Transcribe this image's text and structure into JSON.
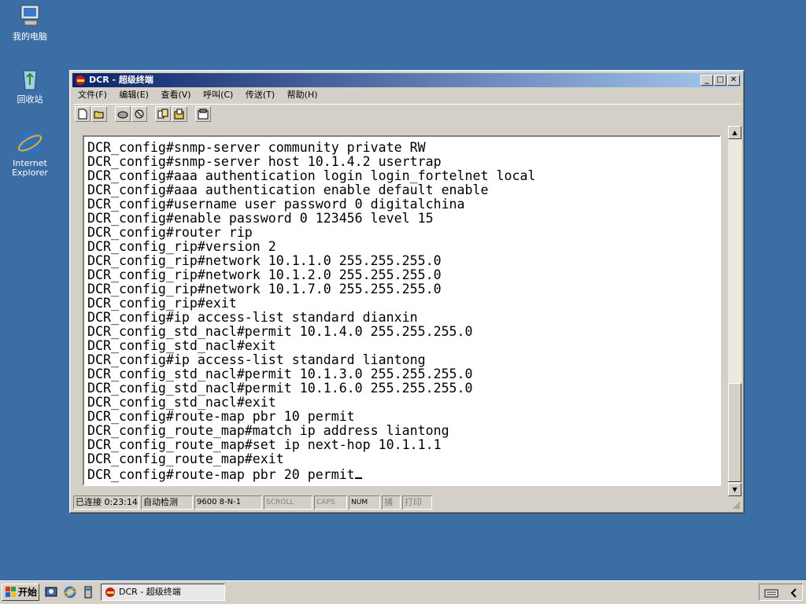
{
  "desktop": {
    "icons": [
      {
        "label": "我的电脑",
        "icon": "my-computer-icon"
      },
      {
        "label": "回收站",
        "icon": "recycle-bin-icon"
      },
      {
        "label": "Internet\nExplorer",
        "icon": "internet-explorer-icon"
      }
    ]
  },
  "window": {
    "title": "DCR - 超级终端",
    "menu": [
      "文件(F)",
      "编辑(E)",
      "查看(V)",
      "呼叫(C)",
      "传送(T)",
      "帮助(H)"
    ],
    "toolbar_icons": [
      "new-icon",
      "open-icon",
      "connect-icon",
      "disconnect-icon",
      "send-icon",
      "receive-icon",
      "properties-icon"
    ],
    "terminal_lines": [
      "DCR_config#snmp-server community private RW",
      "DCR_config#snmp-server host 10.1.4.2 usertrap",
      "DCR_config#aaa authentication login login_fortelnet local",
      "DCR_config#aaa authentication enable default enable",
      "DCR_config#username user password 0 digitalchina",
      "DCR_config#enable password 0 123456 level 15",
      "DCR_config#router rip",
      "DCR_config_rip#version 2",
      "DCR_config_rip#network 10.1.1.0 255.255.255.0",
      "DCR_config_rip#network 10.1.2.0 255.255.255.0",
      "DCR_config_rip#network 10.1.7.0 255.255.255.0",
      "DCR_config_rip#exit",
      "DCR_config#ip access-list standard dianxin",
      "DCR_config_std_nacl#permit 10.1.4.0 255.255.255.0",
      "DCR_config_std_nacl#exit",
      "DCR_config#ip access-list standard liantong",
      "DCR_config_std_nacl#permit 10.1.3.0 255.255.255.0",
      "DCR_config_std_nacl#permit 10.1.6.0 255.255.255.0",
      "DCR_config_std_nacl#exit",
      "DCR_config#route-map pbr 10 permit",
      "DCR_config_route_map#match ip address liantong",
      "DCR_config_route_map#set ip next-hop 10.1.1.1",
      "DCR_config_route_map#exit",
      "DCR_config#route-map pbr 20 permit"
    ],
    "status": {
      "connected": "已连接 0:23:14",
      "detect": "自动检测",
      "baud": "9600 8-N-1",
      "scroll": "SCROLL",
      "caps": "CAPS",
      "num": "NUM",
      "capture": "捕",
      "print": "打印"
    }
  },
  "taskbar": {
    "start_label": "开始",
    "task_label": "DCR - 超级终端"
  },
  "colors": {
    "desktop": "#3a6ea5",
    "title_start": "#0a246a",
    "title_end": "#a6caf0",
    "chrome": "#d4d0c8"
  }
}
